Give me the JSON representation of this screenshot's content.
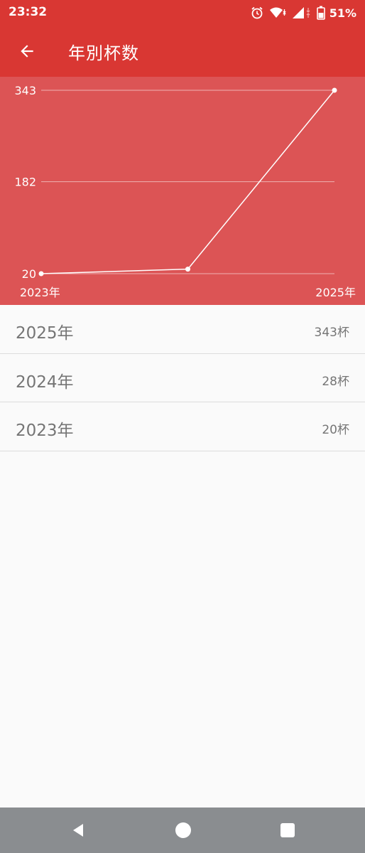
{
  "status_bar": {
    "time": "23:32",
    "battery": "51%"
  },
  "app_bar": {
    "title": "年別杯数"
  },
  "colors": {
    "primary": "#d93733",
    "chart_bg": "#dc5455",
    "nav_bar": "#8a8d90"
  },
  "icons": {
    "back": "arrow-left-icon",
    "alarm": "alarm-clock-icon",
    "wifi": "wifi-icon",
    "signal": "cell-signal-icon",
    "battery": "battery-icon"
  },
  "chart_data": {
    "type": "line",
    "x": [
      "2023年",
      "2024年",
      "2025年"
    ],
    "values": [
      20,
      28,
      343
    ],
    "x_tick_labels": [
      "2023年",
      "2025年"
    ],
    "y_tick_labels": [
      "343",
      "182",
      "20"
    ],
    "y_ticks": [
      343,
      182,
      20
    ],
    "ylim": [
      20,
      343
    ],
    "grid": true,
    "line_color": "#ffffff"
  },
  "year_list": [
    {
      "year": "2025年",
      "count": "343杯"
    },
    {
      "year": "2024年",
      "count": "28杯"
    },
    {
      "year": "2023年",
      "count": "20杯"
    }
  ]
}
